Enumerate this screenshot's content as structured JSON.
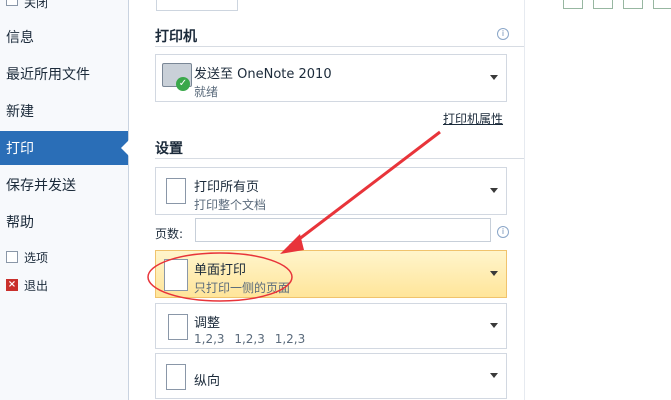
{
  "sidebar": {
    "items": [
      {
        "label": "关闭"
      },
      {
        "label": "信息"
      },
      {
        "label": "最近所用文件"
      },
      {
        "label": "新建"
      },
      {
        "label": "打印"
      },
      {
        "label": "保存并发送"
      },
      {
        "label": "帮助"
      },
      {
        "label": "选项"
      },
      {
        "label": "退出"
      }
    ]
  },
  "main": {
    "printer_section_title": "打印机",
    "printer": {
      "name": "发送至 OneNote 2010",
      "status": "就绪"
    },
    "printer_properties_link": "打印机属性",
    "settings_section_title": "设置",
    "print_range": {
      "title": "打印所有页",
      "sub": "打印整个文档"
    },
    "pages": {
      "label": "页数:",
      "value": ""
    },
    "sides": {
      "title": "单面打印",
      "sub": "只打印一侧的页面"
    },
    "collate": {
      "title": "调整",
      "sub": "1,2,3    1,2,3    1,2,3"
    },
    "orientation": {
      "title": "纵向"
    }
  },
  "colors": {
    "active_sidebar": "#2a6eb7",
    "highlight": "#ffe59a",
    "annotation": "#e8343a"
  }
}
